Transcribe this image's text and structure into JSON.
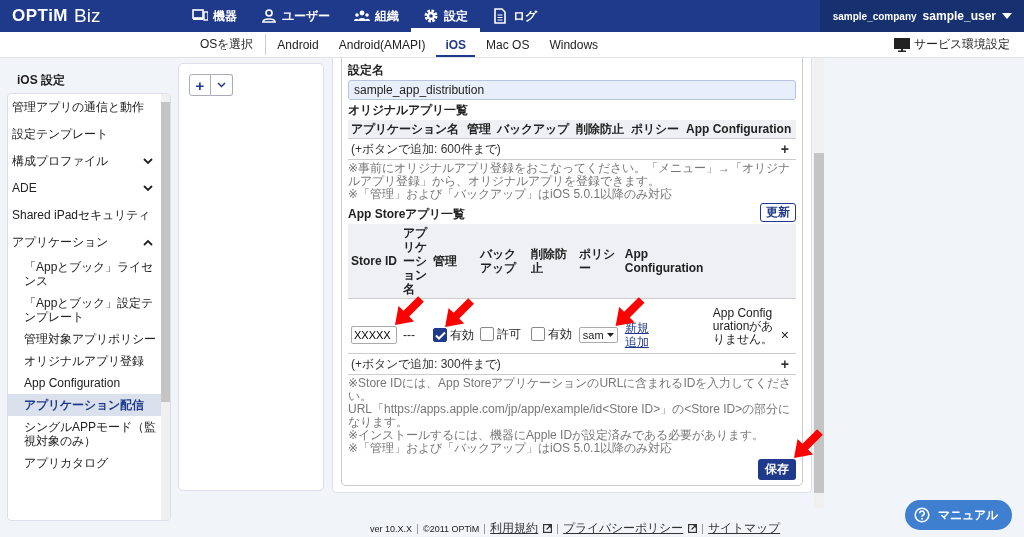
{
  "header": {
    "logo": "OPTiM",
    "logo_suffix": "Biz",
    "nav": [
      {
        "label": "機器",
        "selected": false
      },
      {
        "label": "ユーザー",
        "selected": false
      },
      {
        "label": "組織",
        "selected": false
      },
      {
        "label": "設定",
        "selected": true
      },
      {
        "label": "ログ",
        "selected": false
      }
    ],
    "company": "sample_company",
    "user": "sample_user"
  },
  "subnav": {
    "label": "OSを選択",
    "tabs": [
      {
        "label": "Android",
        "selected": false
      },
      {
        "label": "Android(AMAPI)",
        "selected": false
      },
      {
        "label": "iOS",
        "selected": true
      },
      {
        "label": "Mac OS",
        "selected": false
      },
      {
        "label": "Windows",
        "selected": false
      }
    ],
    "service_settings": "サービス環境設定"
  },
  "sidebar": {
    "title": "iOS 設定",
    "items": [
      {
        "label": "管理アプリの通信と動作",
        "selected": false
      },
      {
        "label": "設定テンプレート",
        "selected": false
      },
      {
        "label": "構成プロファイル",
        "expanded": false,
        "selected": false
      },
      {
        "label": "ADE",
        "expanded": false,
        "selected": false
      },
      {
        "label": "Shared iPadセキュリティ",
        "selected": false
      },
      {
        "label": "アプリケーション",
        "expanded": true,
        "selected": false,
        "children": [
          {
            "label": "「Appとブック」ライセンス",
            "selected": false
          },
          {
            "label": "「Appとブック」設定テンプレート",
            "selected": false
          },
          {
            "label": "管理対象アプリポリシー",
            "selected": false
          },
          {
            "label": "オリジナルアプリ登録",
            "selected": false
          },
          {
            "label": "App Configuration",
            "selected": false
          },
          {
            "label": "アプリケーション配信",
            "selected": true
          },
          {
            "label": "シングルAPPモード（監視対象のみ）",
            "selected": false
          },
          {
            "label": "アプリカタログ",
            "selected": false
          }
        ]
      }
    ]
  },
  "toolbar": {
    "add_button": "+"
  },
  "form": {
    "name_label": "設定名",
    "name_value": "sample_app_distribution",
    "original_apps": {
      "title": "オリジナルアプリ一覧",
      "columns": [
        "アプリケーション名",
        "管理",
        "バックアップ",
        "削除防止",
        "ポリシー",
        "App Configuration"
      ],
      "add_row": "(+ボタンで追加: 600件まで)",
      "add_button": "+",
      "notes": [
        "※事前にオリジナルアプリ登録をおこなってください。「メニュー」→「オリジナルアプリ登録」から、オリジナルアプリを登録できます。",
        "※「管理」および「バックアップ」はiOS 5.0.1以降のみ対応"
      ]
    },
    "store_apps": {
      "title": "App Storeアプリ一覧",
      "refresh_button": "更新",
      "columns": [
        "Store ID",
        "アプリケーション名",
        "管理",
        "バックアップ",
        "削除防止",
        "ポリシー",
        "App Configuration"
      ],
      "rows": [
        {
          "store_id": "XXXXX",
          "app_name": "---",
          "manage": {
            "label": "有効",
            "checked": true
          },
          "backup": {
            "label": "許可",
            "checked": false
          },
          "delete_protection": {
            "label": "有効",
            "checked": false
          },
          "policy": "sam",
          "new_link": "新規追加",
          "app_config": "App Configurationがありません。",
          "remove": "×"
        }
      ],
      "add_row": "(+ボタンで追加: 300件まで)",
      "add_button": "+",
      "notes": [
        "※Store IDには、App StoreアプリケーションのURLに含まれるIDを入力してください。",
        "URL「https://apps.apple.com/jp/app/example/id<Store ID>」の<Store ID>の部分になります。",
        "※インストールするには、機器にApple IDが設定済みである必要があります。",
        "※「管理」および「バックアップ」はiOS 5.0.1以降のみ対応"
      ]
    },
    "save_button": "保存"
  },
  "footer": {
    "version": "ver 10.X.X",
    "copyright": "©2011 OPTiM",
    "links": [
      {
        "label": "利用規約",
        "external": true
      },
      {
        "label": "プライバシーポリシー",
        "external": true
      },
      {
        "label": "サイトマップ",
        "external": false
      }
    ]
  },
  "manual_button": "マニュアル"
}
